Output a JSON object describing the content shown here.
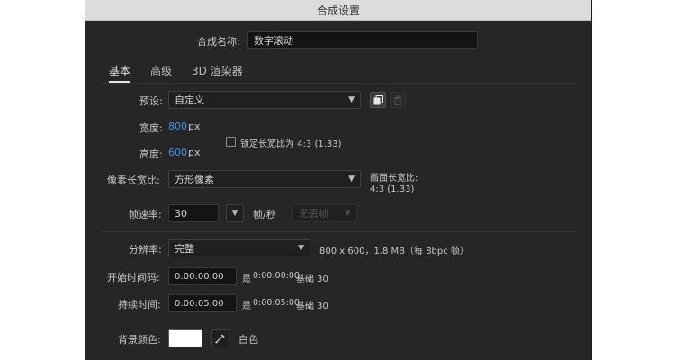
{
  "dialog": {
    "title": "合成设置",
    "comp_name_label": "合成名称:",
    "comp_name_value": "数字滚动",
    "tabs": [
      {
        "label": "基本",
        "active": true
      },
      {
        "label": "高级",
        "active": false
      },
      {
        "label": "3D 渲染器",
        "active": false
      }
    ],
    "preset": {
      "label": "预设:",
      "value": "自定义"
    },
    "width": {
      "label": "宽度:",
      "value": "800",
      "unit": "px"
    },
    "height": {
      "label": "高度:",
      "value": "600",
      "unit": "px"
    },
    "lock_aspect": {
      "label": "锁定长宽比为 4:3 (1.33)",
      "checked": false
    },
    "pixel_aspect": {
      "label": "像素长宽比:",
      "value": "方形像素"
    },
    "frame_aspect": {
      "label": "画面长宽比:",
      "value": "4:3 (1.33)"
    },
    "frame_rate": {
      "label": "帧速率:",
      "value": "30",
      "unit": "帧/秒",
      "drop_frame": "无丢帧"
    },
    "resolution": {
      "label": "分辨率:",
      "value": "完整",
      "info": "800 x 600，1.8 MB（每 8bpc 帧）"
    },
    "start_timecode": {
      "label": "开始时间码:",
      "value": "0:00:00:00",
      "info_prefix": "是",
      "info_time": "0:00:00:00",
      "info_base": "基础 30"
    },
    "duration": {
      "label": "持续时间:",
      "value": "0:00:05:00",
      "info_prefix": "是",
      "info_time": "0:00:05:00",
      "info_base": "基础 30"
    },
    "background": {
      "label": "背景颜色:",
      "color_name": "白色",
      "color": "#ffffff"
    },
    "colors": {
      "accent_value": "#3f94e6",
      "panel_bg": "#262626",
      "titlebar": "#dcdcdc"
    },
    "icons": {
      "save_preset": "save-preset-icon",
      "delete_preset": "trash-icon",
      "eyedropper": "eyedropper-icon"
    }
  }
}
